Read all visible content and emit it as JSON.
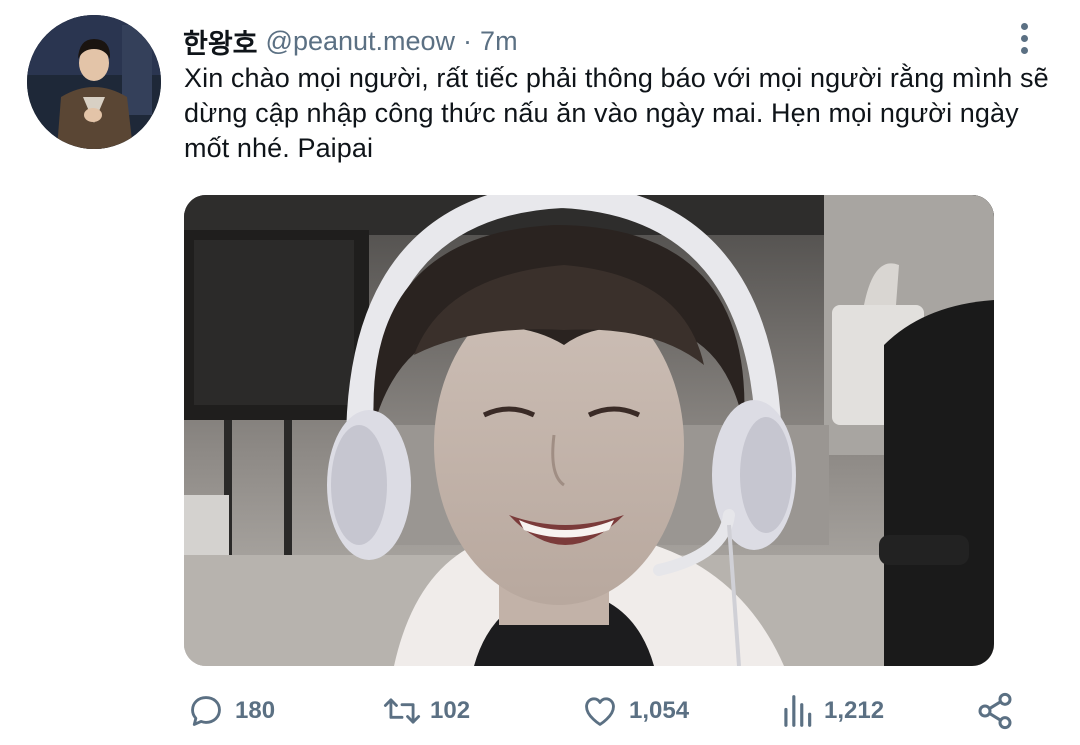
{
  "tweet": {
    "display_name": "한왕호",
    "handle": "@peanut.meow",
    "separator": "·",
    "time": "7m",
    "text": "Xin chào mọi người, rất tiếc phải thông báo với mọi người rằng mình sẽ dừng cập nhập công thức nấu ăn vào ngày mai. Hẹn mọi người ngày mốt nhé. Paipai"
  },
  "actions": {
    "replies": "180",
    "retweets": "102",
    "likes": "1,054",
    "views": "1,212"
  },
  "icons": {
    "more": "more-vertical-icon",
    "reply": "reply-icon",
    "retweet": "retweet-icon",
    "like": "heart-icon",
    "views": "views-icon",
    "share": "share-icon"
  },
  "colors": {
    "text": "#0f1419",
    "secondary": "#5b7083",
    "background": "#ffffff"
  }
}
